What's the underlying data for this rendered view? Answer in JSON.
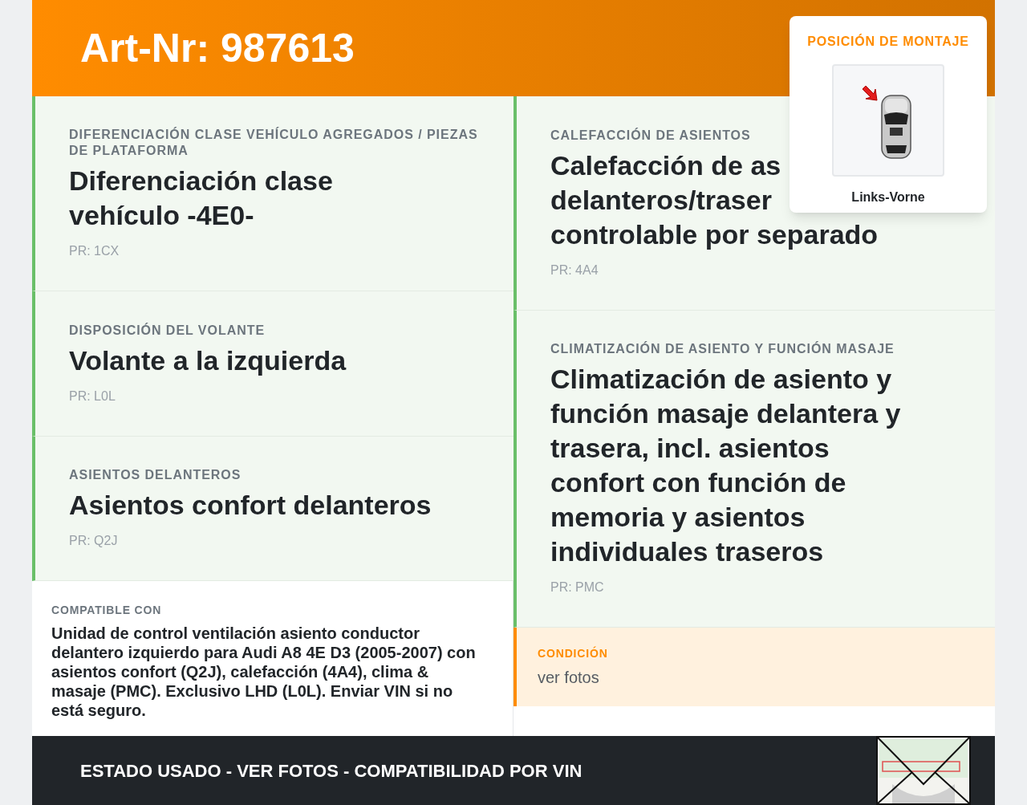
{
  "header": {
    "title": "Art-Nr: 987613"
  },
  "mounting": {
    "label": "POSICIÓN DE MONTAJE",
    "position": "Links-Vorne"
  },
  "left_cards": [
    {
      "label": "DIFERENCIACIÓN CLASE VEHÍCULO AGREGADOS / PIEZAS DE PLATAFORMA",
      "title_lines": [
        "Diferenciación clase vehículo -4E0-"
      ],
      "pr": "PR: 1CX"
    },
    {
      "label": "DISPOSICIÓN DEL VOLANTE",
      "title_lines": [
        "Volante a la izquierda"
      ],
      "pr": "PR: L0L"
    },
    {
      "label": "ASIENTOS DELANTEROS",
      "title_lines": [
        "Asientos confort delanteros"
      ],
      "pr": "PR: Q2J"
    }
  ],
  "compatible": {
    "label": "COMPATIBLE CON",
    "text": "Unidad de control ventilación asiento conductor delantero izquierdo para Audi A8 4E D3 (2005-2007) con asientos confort (Q2J), calefacción (4A4), clima & masaje (PMC). Exclusivo LHD (L0L). Enviar VIN si no está seguro."
  },
  "right_cards": [
    {
      "label": "CALEFACCIÓN DE ASIENTOS",
      "title_lines": [
        "Calefacción de as",
        "delanteros/traser",
        "controlable por separado"
      ],
      "pr": "PR: 4A4"
    },
    {
      "label": "CLIMATIZACIÓN DE ASIENTO Y FUNCIÓN MASAJE",
      "title_lines": [
        "Climatización de asiento y función masaje delantera y trasera, incl. asientos confort con función de memoria y asientos individuales traseros"
      ],
      "pr": "PR: PMC"
    }
  ],
  "condition": {
    "label": "CONDICIÓN",
    "value": "ver fotos"
  },
  "footer": {
    "text": "ESTADO USADO - VER FOTOS - COMPATIBILIDAD POR VIN"
  }
}
